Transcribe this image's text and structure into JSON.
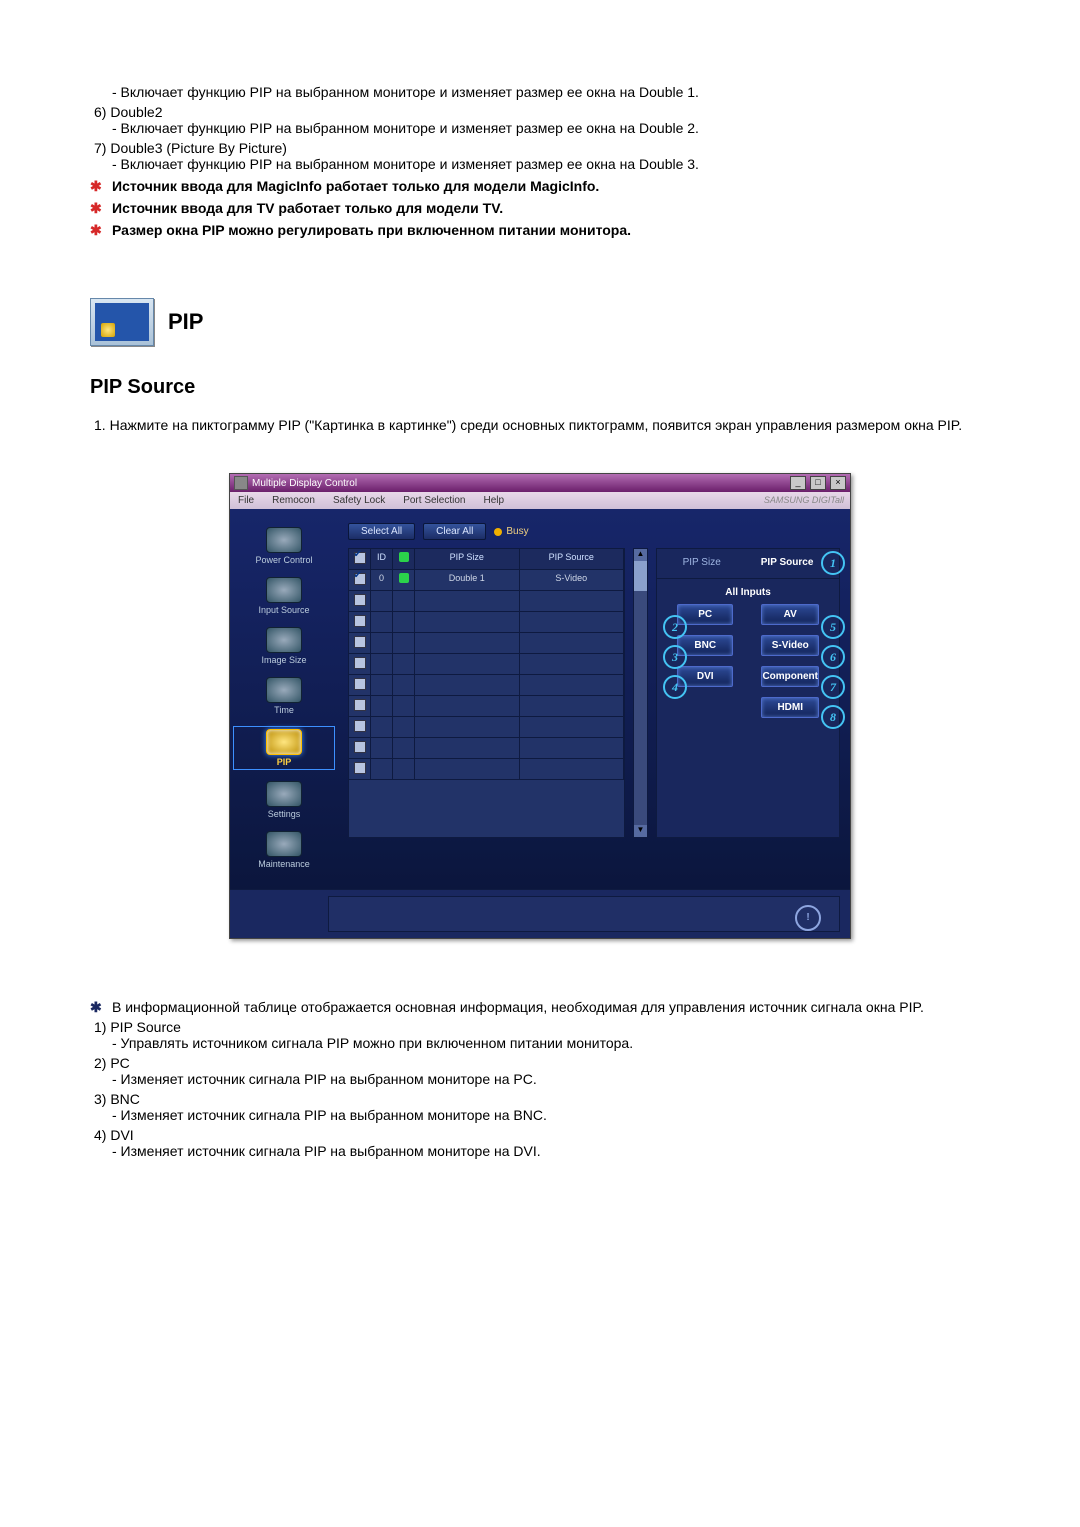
{
  "top_list": [
    {
      "desc": "- Включает функцию PIP на выбранном мониторе и изменяет размер ее окна на Double 1."
    },
    {
      "num": "6)",
      "title": "Double2",
      "desc": "- Включает функцию PIP на выбранном мониторе и изменяет размер ее окна на Double 2."
    },
    {
      "num": "7)",
      "title": "Double3 (Picture By Picture)",
      "desc": "- Включает функцию PIP на выбранном мониторе и изменяет размер ее окна на Double 3."
    }
  ],
  "top_notes": [
    "Источник ввода для MagicInfo работает только для модели MagicInfo.",
    "Источник ввода для TV работает только для модели TV.",
    "Размер окна PIP можно регулировать при включенном питании монитора."
  ],
  "pip_section_label": "PIP",
  "subsection": "PIP Source",
  "intro": {
    "num": "1.",
    "text": "Нажмите на пиктограмму PIP (\"Картинка в картинке\") среди основных пиктограмм, появится экран управления размером окна PIP."
  },
  "mdc": {
    "title": "Multiple Display Control",
    "menu": [
      "File",
      "Remocon",
      "Safety Lock",
      "Port Selection",
      "Help"
    ],
    "brand": "SAMSUNG DIGITall",
    "sidebar": [
      {
        "label": "Power Control"
      },
      {
        "label": "Input Source"
      },
      {
        "label": "Image Size"
      },
      {
        "label": "Time"
      },
      {
        "label": "PIP",
        "selected": true
      },
      {
        "label": "Settings"
      },
      {
        "label": "Maintenance"
      }
    ],
    "buttons": {
      "select_all": "Select All",
      "clear_all": "Clear All",
      "busy": "Busy"
    },
    "table": {
      "headers": [
        "",
        "ID",
        "",
        "PIP Size",
        "PIP Source"
      ],
      "row": {
        "id": "0",
        "size": "Double 1",
        "source": "S-Video"
      },
      "empty_rows": 9
    },
    "panel": {
      "tabs": {
        "left": "PIP Size",
        "right": "PIP Source"
      },
      "section": "All Inputs",
      "sources": {
        "left": [
          "PC",
          "BNC",
          "DVI"
        ],
        "right": [
          "AV",
          "S-Video",
          "Component",
          "HDMI"
        ]
      }
    }
  },
  "bottom_star": "В информационной таблице отображается основная информация, необходимая для управления источник сигнала окна PIP.",
  "bottom_list": [
    {
      "num": "1)",
      "title": "PIP Source",
      "desc": "- Управлять источником сигнала PIP можно при включенном питании монитора."
    },
    {
      "num": "2)",
      "title": "PC",
      "desc": "- Изменяет источник сигнала PIP на выбранном мониторе на PC."
    },
    {
      "num": "3)",
      "title": "BNC",
      "desc": "- Изменяет источник сигнала PIP на выбранном мониторе на BNC."
    },
    {
      "num": "4)",
      "title": "DVI",
      "desc": "- Изменяет источник сигнала PIP на выбранном мониторе на DVI."
    }
  ]
}
